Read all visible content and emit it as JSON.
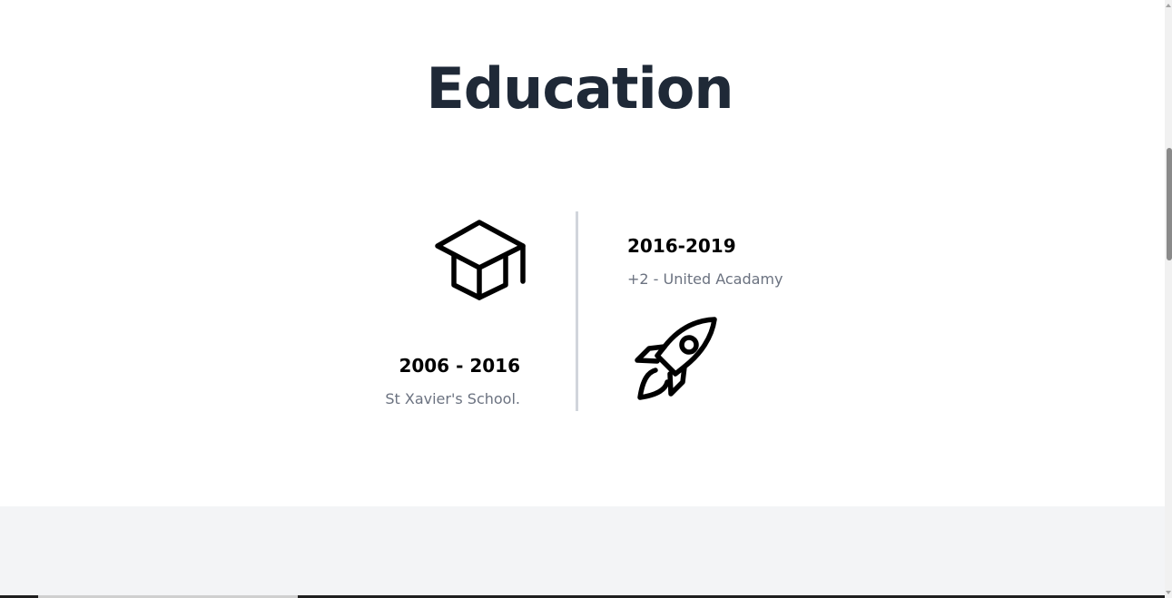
{
  "section": {
    "title": "Education"
  },
  "timeline": [
    {
      "years": "2016-2019",
      "school": "+2 - United Acadamy",
      "icon": "rocket-icon",
      "side": "right"
    },
    {
      "years": "2006 - 2016",
      "school": "St Xavier's School.",
      "icon": "graduation-cap-icon",
      "side": "left"
    }
  ],
  "colors": {
    "title": "#1f2937",
    "year": "#000000",
    "school": "#6b7280",
    "timeline_line": "#d1d5db",
    "next_section_bg": "#f3f4f6"
  }
}
